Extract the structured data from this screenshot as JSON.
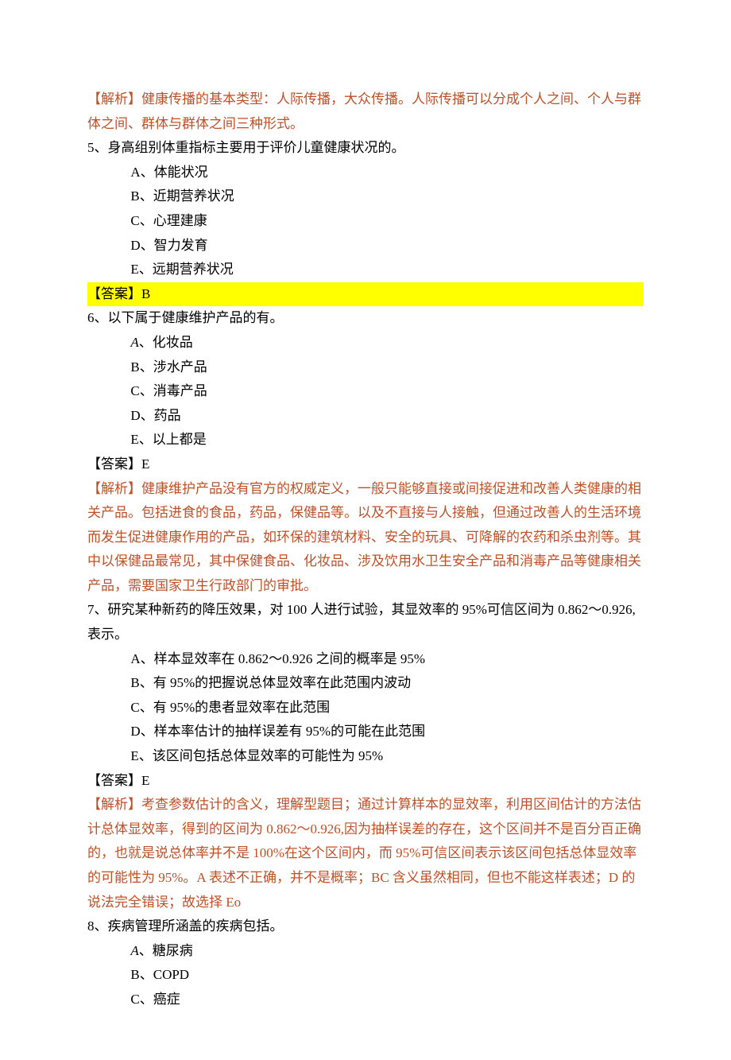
{
  "q4": {
    "analysis": "【解析】健康传播的基本类型：人际传播，大众传播。人际传播可以分成个人之间、个人与群体之间、群体与群体之间三种形式。"
  },
  "q5": {
    "stem": "5、身高组别体重指标主要用于评价儿童健康状况的。",
    "optA": "A、体能状况",
    "optB": "B、近期营养状况",
    "optC": "C、心理建康",
    "optD": "D、智力发育",
    "optE": "E、远期营养状况",
    "answer": "【答案】B"
  },
  "q6": {
    "stem": "6、以下属于健康维护产品的有。",
    "optA_prefix": "A",
    "optA_rest": "、化妆品",
    "optB": "B、涉水产品",
    "optC": "C、消毒产品",
    "optD": "D、药品",
    "optE": "E、以上都是",
    "answer": "【答案】E",
    "analysis": "【解析】健康维护产品没有官方的权威定义，一般只能够直接或间接促进和改善人类健康的相关产品。包括进食的食品，药品，保健品等。以及不直接与人接触，但通过改善人的生活环境而发生促进健康作用的产品，如环保的建筑材料、安全的玩具、可降解的农药和杀虫剂等。其中以保健品最常见，其中保健食品、化妆品、涉及饮用水卫生安全产品和消毒产品等健康相关产品，需要国家卫生行政部门的审批。"
  },
  "q7": {
    "stem": "7、研究某种新药的降压效果，对 100 人进行试验，其显效率的 95%可信区间为 0.862～0.926,表示。",
    "optA": "A、样本显效率在 0.862～0.926 之间的概率是 95%",
    "optB": "B、有 95%的把握说总体显效率在此范围内波动",
    "optC": "C、有 95%的患者显效率在此范围",
    "optD": "D、样本率估计的抽样误差有 95%的可能在此范围",
    "optE": "E、该区间包括总体显效率的可能性为 95%",
    "answer": "【答案】E",
    "analysis": "【解析】考查参数估计的含义，理解型题目；通过计算样本的显效率，利用区间估计的方法估计总体显效率，得到的区间为 0.862～0.926,因为抽样误差的存在，这个区间并不是百分百正确的，也就是说总体率并不是 100%在这个区间内，而 95%可信区间表示该区间包括总体显效率的可能性为 95%。A 表述不正确，并不是概率；BC 含义虽然相同，但也不能这样表述；D 的说法完全错误；故选择 Eo"
  },
  "q8": {
    "stem": "8、疾病管理所涵盖的疾病包括。",
    "optA_prefix": "A",
    "optA_rest": "、糖尿病",
    "optB": "B、COPD",
    "optC": "C、癌症"
  }
}
